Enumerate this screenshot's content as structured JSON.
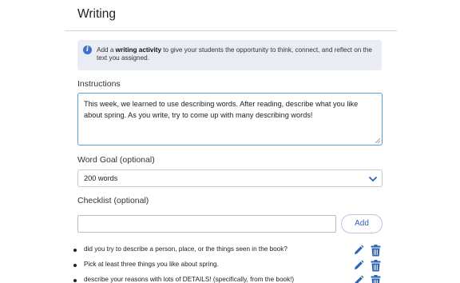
{
  "panel": {
    "title": "Writing"
  },
  "info": {
    "icon": "info-icon",
    "icon_color": "#3f71c9",
    "text_prefix": "Add a ",
    "text_bold": "writing activity",
    "text_suffix": " to give your students the opportunity to think, connect, and reflect on the text you assigned."
  },
  "instructions": {
    "label": "Instructions",
    "value": "This week, we learned to use describing words. After reading, describe what you like about spring. As you write, try to come up with many describing words!"
  },
  "word_goal": {
    "label": "Word Goal (optional)",
    "selected": "200 words",
    "icon": "chevron-down-icon"
  },
  "checklist": {
    "label": "Checklist (optional)",
    "input_value": "",
    "add_label": "Add",
    "items": [
      {
        "text": "did you try to describe a person, place, or the things seen in the book?"
      },
      {
        "text": "Pick at least three things you like about spring."
      },
      {
        "text": "describe your reasons with lots of DETAILS! (specifically, from the book!)"
      }
    ]
  },
  "colors": {
    "accent": "#2e62b5",
    "focus_border": "#5b9bd5",
    "info_background": "#e9edf3"
  }
}
